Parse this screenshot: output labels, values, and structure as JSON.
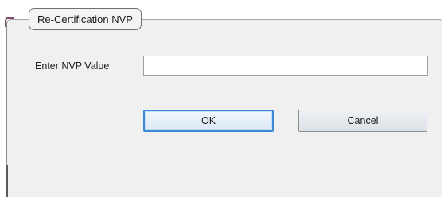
{
  "dialog": {
    "title": "Re-Certification NVP",
    "field_label": "Enter NVP Value",
    "field_value": "",
    "field_placeholder": "",
    "ok_label": "OK",
    "cancel_label": "Cancel"
  },
  "colors": {
    "dialog_background": "#f0f0f0",
    "ok_border_focus": "#3c8ad6",
    "input_border": "#9aa0aa"
  }
}
